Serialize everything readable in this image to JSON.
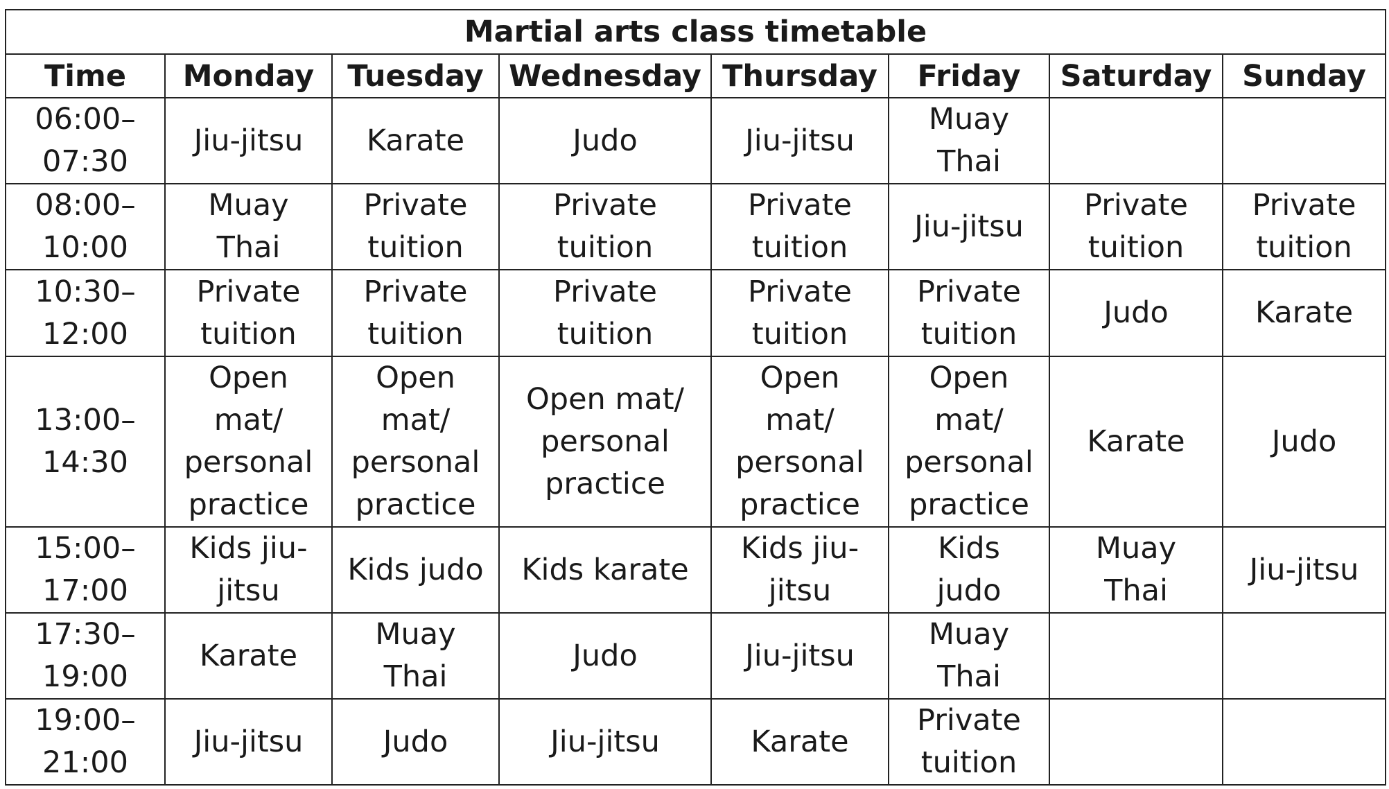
{
  "title": "Martial arts class timetable",
  "headers": [
    "Time",
    "Monday",
    "Tuesday",
    "Wednesday",
    "Thursday",
    "Friday",
    "Saturday",
    "Sunday"
  ],
  "rows": [
    {
      "time": "06:00–\n07:30",
      "cells": [
        "Jiu-jitsu",
        "Karate",
        "Judo",
        "Jiu-jitsu",
        "Muay\nThai",
        "",
        ""
      ]
    },
    {
      "time": "08:00–\n10:00",
      "cells": [
        "Muay\nThai",
        "Private\ntuition",
        "Private\ntuition",
        "Private\ntuition",
        "Jiu-jitsu",
        "Private\ntuition",
        "Private\ntuition"
      ]
    },
    {
      "time": "10:30–\n12:00",
      "cells": [
        "Private\ntuition",
        "Private\ntuition",
        "Private\ntuition",
        "Private\ntuition",
        "Private\ntuition",
        "Judo",
        "Karate"
      ]
    },
    {
      "time": "13:00–\n14:30",
      "cells": [
        "Open\nmat/\npersonal\npractice",
        "Open\nmat/\npersonal\npractice",
        "Open mat/\npersonal\npractice",
        "Open\nmat/\npersonal\npractice",
        "Open\nmat/\npersonal\npractice",
        "Karate",
        "Judo"
      ]
    },
    {
      "time": "15:00–\n17:00",
      "cells": [
        "Kids jiu-\njitsu",
        "Kids judo",
        "Kids karate",
        "Kids jiu-\njitsu",
        "Kids\njudo",
        "Muay\nThai",
        "Jiu-jitsu"
      ]
    },
    {
      "time": "17:30–\n19:00",
      "cells": [
        "Karate",
        "Muay\nThai",
        "Judo",
        "Jiu-jitsu",
        "Muay\nThai",
        "",
        ""
      ]
    },
    {
      "time": "19:00–\n21:00",
      "cells": [
        "Jiu-jitsu\n ",
        "Judo",
        "Jiu-jitsu",
        "Karate",
        "Private\ntuition",
        "",
        ""
      ]
    }
  ]
}
